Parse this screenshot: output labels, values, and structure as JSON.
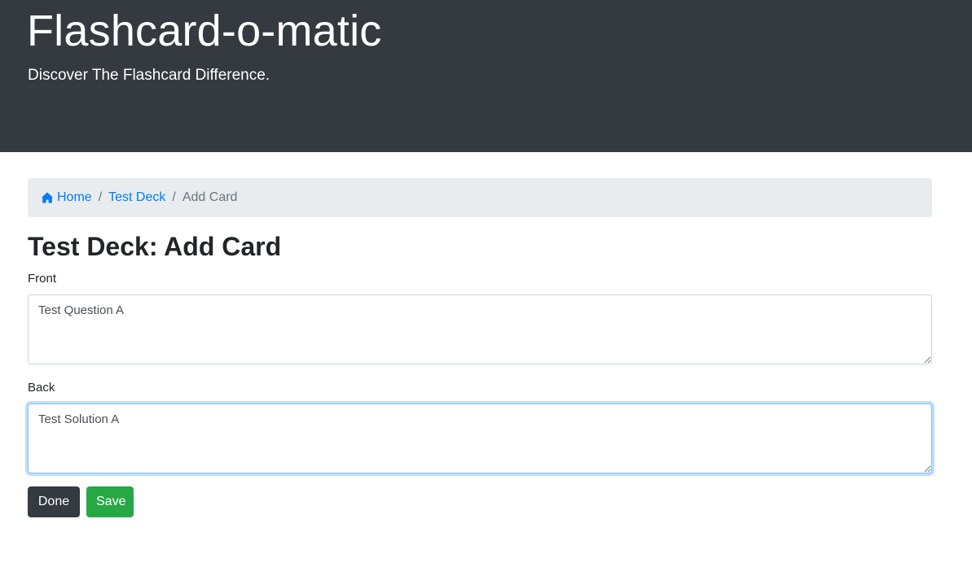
{
  "header": {
    "title": "Flashcard-o-matic",
    "tagline": "Discover The Flashcard Difference."
  },
  "breadcrumb": {
    "home_icon": "home-icon",
    "home_label": "Home",
    "deck_label": "Test Deck",
    "current_label": "Add Card",
    "separator": "/"
  },
  "page": {
    "title": "Test Deck: Add Card"
  },
  "form": {
    "front_label": "Front",
    "front_value": "Test Question A",
    "back_label": "Back",
    "back_value": "Test Solution A"
  },
  "buttons": {
    "done_label": "Done",
    "save_label": "Save"
  },
  "colors": {
    "header_bg": "#343a40",
    "link": "#007bff",
    "done_bg": "#343a40",
    "save_bg": "#28a745"
  }
}
